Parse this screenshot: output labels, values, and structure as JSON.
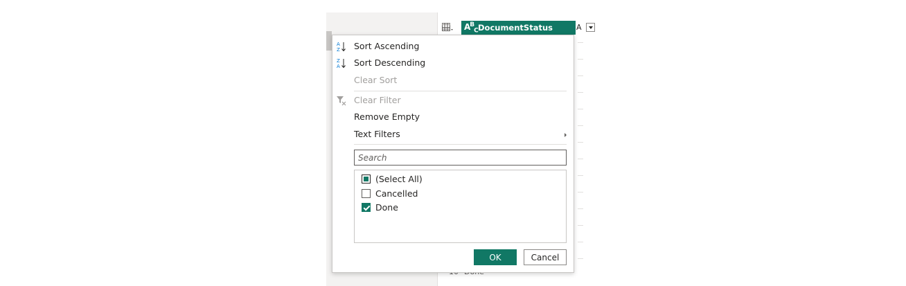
{
  "grid": {
    "column_header": {
      "type_glyph": "A",
      "type_glyph_sup": "B",
      "type_glyph_sub": "C",
      "label": "DocumentStatus",
      "next_column_initial": "A"
    },
    "bottom_row": {
      "number": "10",
      "value": "Done"
    }
  },
  "menu": {
    "sort_ascending": "Sort Ascending",
    "sort_descending": "Sort Descending",
    "clear_sort": "Clear Sort",
    "clear_filter": "Clear Filter",
    "remove_empty": "Remove Empty",
    "text_filters": "Text Filters",
    "search_placeholder": "Search",
    "values": [
      {
        "label": "(Select All)",
        "state": "partial"
      },
      {
        "label": "Cancelled",
        "state": "unchecked"
      },
      {
        "label": "Done",
        "state": "checked"
      }
    ],
    "ok": "OK",
    "cancel": "Cancel"
  },
  "colors": {
    "accent": "#117865",
    "border": "#c8c6c4",
    "disabled_text": "#a19f9d"
  },
  "icons": {
    "sort_ascending": "sort-ascending-icon",
    "sort_descending": "sort-descending-icon",
    "clear_filter": "clear-filter-icon",
    "table": "table-icon",
    "dropdown": "chevron-down-icon",
    "submenu": "chevron-right-icon"
  }
}
